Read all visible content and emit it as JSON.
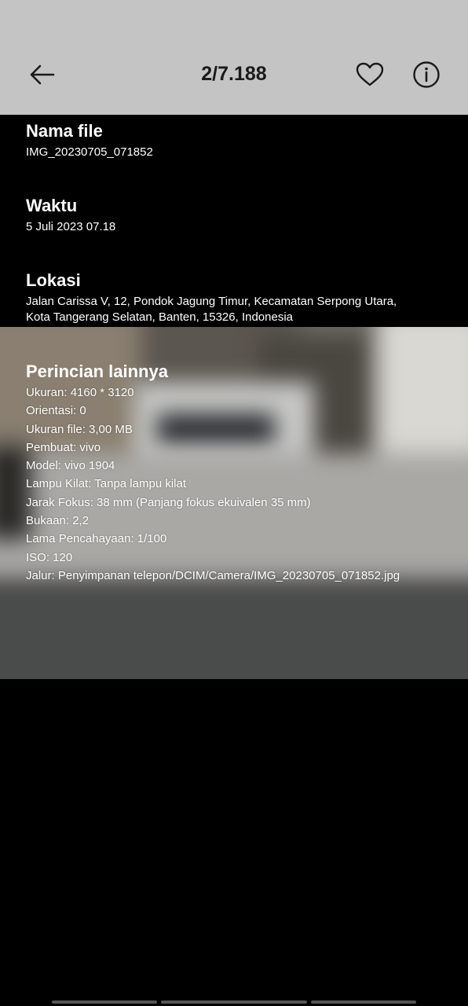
{
  "header": {
    "counter": "2/7.188",
    "back_icon": "arrow-left-icon",
    "favorite_icon": "heart-outline-icon",
    "info_icon": "info-circle-icon"
  },
  "details": {
    "file_name": {
      "title": "Nama file",
      "value": "IMG_20230705_071852"
    },
    "time": {
      "title": "Waktu",
      "value": "5 Juli 2023 07.18"
    },
    "location": {
      "title": "Lokasi",
      "line1": "Jalan Carissa V, 12, Pondok Jagung Timur, Kecamatan Serpong Utara,",
      "line2": "Kota Tangerang Selatan, Banten, 15326, Indonesia"
    },
    "more": {
      "title": "Perincian lainnya",
      "lines": [
        "Ukuran: 4160 * 3120",
        "Orientasi: 0",
        "Ukuran file: 3,00 MB",
        "Pembuat: vivo",
        "Model: vivo 1904",
        "Lampu Kilat: Tanpa lampu kilat",
        "Jarak Fokus: 38 mm (Panjang fokus ekuivalen 35 mm)",
        "Bukaan: 2,2",
        "Lama Pencahayaan: 1/100",
        "ISO: 120",
        "Jalur: Penyimpanan telepon/DCIM/Camera/IMG_20230705_071852.jpg"
      ]
    }
  },
  "colors": {
    "topbar_bg": "#c4c4c4",
    "background": "#000000",
    "text": "#ffffff"
  }
}
